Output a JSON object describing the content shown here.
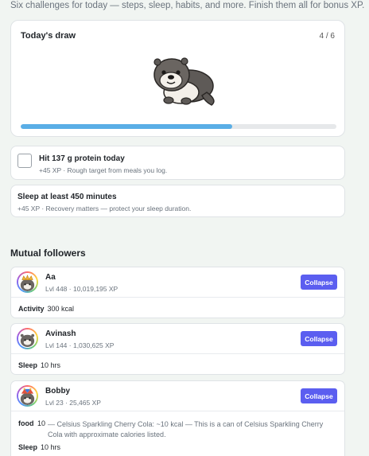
{
  "intro": "Six challenges for today — steps, sleep, habits, and more. Finish them all for bonus XP.",
  "draw": {
    "title": "Today's draw",
    "count": "4 / 6",
    "mascot_icon": "otter-mascot-icon",
    "progress_fraction": 0.67,
    "progress_color": "#5aaee6"
  },
  "challenges": [
    {
      "title": "Hit 137 g protein today",
      "subtitle": "+45 XP · Rough target from meals you log.",
      "has_checkbox": true,
      "checked": false
    },
    {
      "title": "Sleep at least 450 minutes",
      "subtitle": "+45 XP · Recovery matters — protect your sleep duration.",
      "has_checkbox": false
    }
  ],
  "mutual": {
    "title": "Mutual followers",
    "collapse_label": "Collapse",
    "accent": "#5b5ef0",
    "followers": [
      {
        "name": "Aa",
        "meta": "Lvl 448 · 10,019,195 XP",
        "avatar_icon": "crowned-otter-avatar-icon",
        "stats": [
          {
            "label": "Activity",
            "value": "300 kcal"
          }
        ]
      },
      {
        "name": "Avinash",
        "meta": "Lvl 144 · 1,030,625 XP",
        "avatar_icon": "otter-avatar-icon",
        "stats": [
          {
            "label": "Sleep",
            "value": "10 hrs"
          }
        ]
      },
      {
        "name": "Bobby",
        "meta": "Lvl 23 · 25,465 XP",
        "avatar_icon": "jester-otter-avatar-icon",
        "food": {
          "label": "food",
          "qty": "10",
          "desc": "— Celsius Sparkling Cherry Cola: ~10 kcal — This is a can of Celsius Sparkling Cherry Cola with approximate calories listed."
        },
        "stats": [
          {
            "label": "Sleep",
            "value": "10 hrs"
          }
        ]
      }
    ]
  }
}
